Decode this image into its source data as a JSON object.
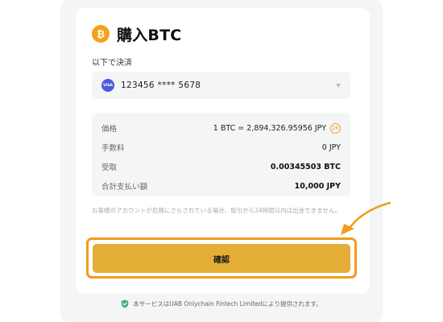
{
  "header": {
    "title": "購入BTC",
    "icon": "bitcoin-icon"
  },
  "payment": {
    "label": "以下で決済",
    "card_brand": "VISA",
    "card_number": "123456 **** 5678"
  },
  "summary": {
    "rows": [
      {
        "label": "価格",
        "value": "1 BTC = 2,894,326.95956 JPY",
        "badge": "26"
      },
      {
        "label": "手数料",
        "value": "0 JPY"
      },
      {
        "label": "受取",
        "value": "0.00345503 BTC"
      },
      {
        "label": "合計支払い額",
        "value": "10,000 JPY"
      }
    ]
  },
  "notice": "お客様のアカウントが危険にさらされている場合、取引から24時間以内は出金できません。",
  "confirm_label": "確認",
  "footer": "本サービスはUAB Onlychain Fintech Limitedにより提供されます。",
  "colors": {
    "accent": "#f2a21b",
    "button": "#e3ad36",
    "highlight": "#f29b1b",
    "shield": "#3cb371"
  }
}
